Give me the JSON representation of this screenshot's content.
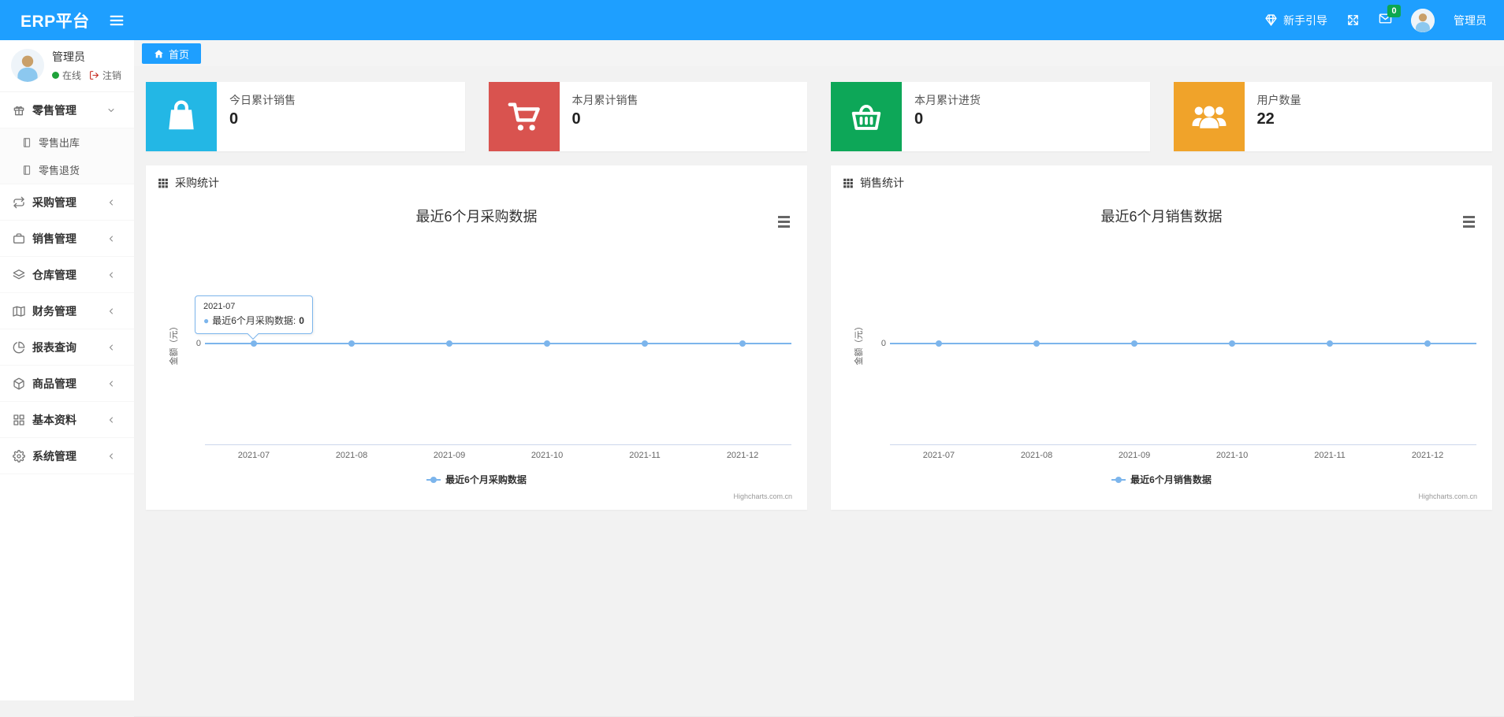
{
  "colors": {
    "accent": "#1E9FFF",
    "chart_line": "#7cb5ec",
    "badge_green": "#0ca750",
    "online_dot": "#1ea23a",
    "logout_red": "#c7281c"
  },
  "navbar": {
    "brand": "ERP平台",
    "burger_icon": "hamburger-icon",
    "guide": {
      "label": "新手引导",
      "icon": "gem-icon"
    },
    "fullscreen_icon": "expand-icon",
    "message": {
      "icon": "envelope-icon",
      "badge": "0"
    },
    "user": {
      "avatar_icon": "avatar",
      "name": "管理员"
    }
  },
  "sidebar": {
    "user": {
      "avatar_icon": "avatar",
      "name": "管理员",
      "status": "在线",
      "logout": "注销"
    },
    "menu": [
      {
        "key": "retail",
        "label": "零售管理",
        "icon": "gift-icon",
        "expanded": true,
        "children": [
          {
            "key": "retail-out",
            "label": "零售出库",
            "icon": "doc-icon"
          },
          {
            "key": "retail-return",
            "label": "零售退货",
            "icon": "doc-icon"
          }
        ]
      },
      {
        "key": "purchase",
        "label": "采购管理",
        "icon": "exchange-icon"
      },
      {
        "key": "sales",
        "label": "销售管理",
        "icon": "briefcase-icon"
      },
      {
        "key": "warehouse",
        "label": "仓库管理",
        "icon": "layers-icon"
      },
      {
        "key": "finance",
        "label": "财务管理",
        "icon": "map-icon"
      },
      {
        "key": "report",
        "label": "报表查询",
        "icon": "pie-chart-icon"
      },
      {
        "key": "goods",
        "label": "商品管理",
        "icon": "box-icon"
      },
      {
        "key": "basic",
        "label": "基本资料",
        "icon": "grid-icon"
      },
      {
        "key": "system",
        "label": "系统管理",
        "icon": "gear-icon"
      }
    ]
  },
  "tabbar": {
    "tabs": [
      {
        "label": "首页",
        "icon": "home-icon",
        "active": true
      }
    ]
  },
  "cards": [
    {
      "key": "today-sales",
      "label": "今日累计销售",
      "value": "0",
      "color": "#23b7e5",
      "icon": "shopping-bag-icon"
    },
    {
      "key": "month-sales",
      "label": "本月累计销售",
      "value": "0",
      "color": "#d9534f",
      "icon": "shopping-cart-icon"
    },
    {
      "key": "month-purchase",
      "label": "本月累计进货",
      "value": "0",
      "color": "#0da758",
      "icon": "shopping-basket-icon"
    },
    {
      "key": "user-count",
      "label": "用户数量",
      "value": "22",
      "color": "#f0a32a",
      "icon": "users-icon"
    }
  ],
  "panels": [
    {
      "key": "purchase-stats",
      "header": "采购统计",
      "icon": "th-icon"
    },
    {
      "key": "sales-stats",
      "header": "销售统计",
      "icon": "th-icon"
    }
  ],
  "chart_data": [
    {
      "type": "line",
      "title": "最近6个月采购数据",
      "categories": [
        "2021-07",
        "2021-08",
        "2021-09",
        "2021-10",
        "2021-11",
        "2021-12"
      ],
      "series": [
        {
          "name": "最近6个月采购数据",
          "values": [
            0,
            0,
            0,
            0,
            0,
            0
          ]
        }
      ],
      "ylabel": "金额（元）",
      "yticks": [
        "0"
      ],
      "grid": true,
      "legend_position": "bottom",
      "line_color": "#7cb5ec",
      "credit": "Highcharts.com.cn",
      "tooltip": {
        "visible": true,
        "point_index": 0,
        "category": "2021-07",
        "series": "最近6个月采购数据",
        "value": "0"
      }
    },
    {
      "type": "line",
      "title": "最近6个月销售数据",
      "categories": [
        "2021-07",
        "2021-08",
        "2021-09",
        "2021-10",
        "2021-11",
        "2021-12"
      ],
      "series": [
        {
          "name": "最近6个月销售数据",
          "values": [
            0,
            0,
            0,
            0,
            0,
            0
          ]
        }
      ],
      "ylabel": "金额（元）",
      "yticks": [
        "0"
      ],
      "grid": true,
      "legend_position": "bottom",
      "line_color": "#7cb5ec",
      "credit": "Highcharts.com.cn",
      "tooltip": {
        "visible": false
      }
    }
  ]
}
